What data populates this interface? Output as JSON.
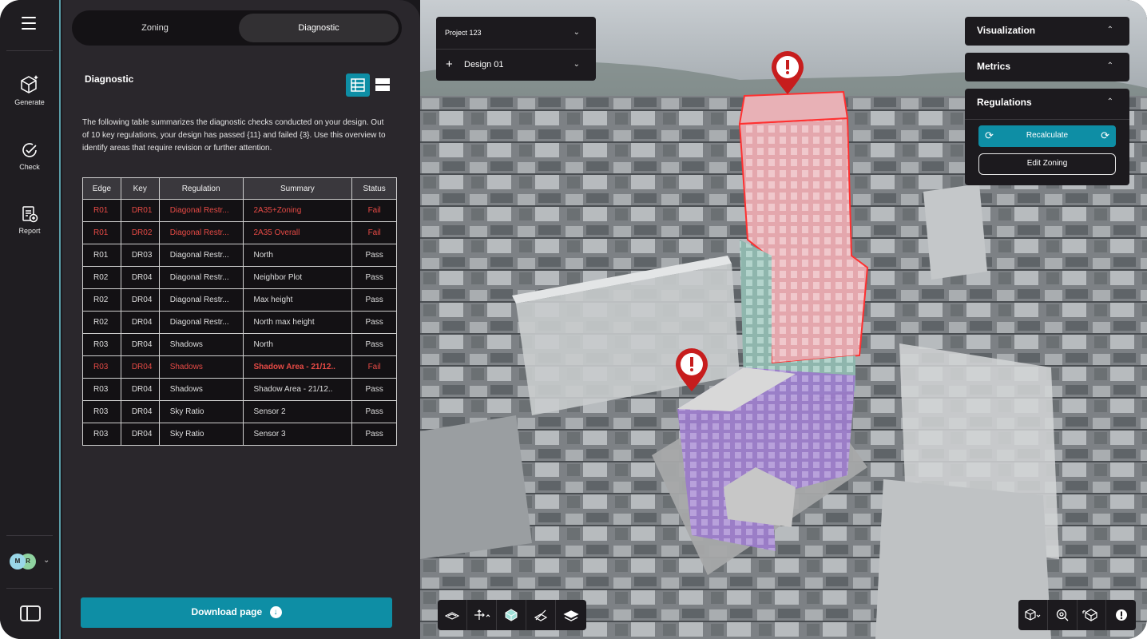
{
  "rail": {
    "items": [
      {
        "label": "Generate",
        "icon": "cube-sparkle-icon"
      },
      {
        "label": "Check",
        "icon": "check-circle-icon"
      },
      {
        "label": "Report",
        "icon": "report-add-icon"
      }
    ],
    "avatars": [
      "M",
      "R"
    ]
  },
  "tabs": {
    "zoning": "Zoning",
    "diagnostic": "Diagnostic"
  },
  "diagnostic": {
    "title": "Diagnostic",
    "intro": "The following table summarizes the diagnostic checks conducted on your design. Out of 10 key regulations, your design has passed {11} and failed {3}. Use this overview to identify areas that require revision or further attention.",
    "columns": [
      "Edge",
      "Key",
      "Regulation",
      "Summary",
      "Status"
    ],
    "rows": [
      {
        "edge": "R01",
        "key": "DR01",
        "regulation": "Diagonal Restr...",
        "summary": "2A35+Zoning",
        "status": "Fail"
      },
      {
        "edge": "R01",
        "key": "DR02",
        "regulation": "Diagonal Restr...",
        "summary": "2A35 Overall",
        "status": "Fail"
      },
      {
        "edge": "R01",
        "key": "DR03",
        "regulation": "Diagonal Restr...",
        "summary": "North",
        "status": "Pass"
      },
      {
        "edge": "R02",
        "key": "DR04",
        "regulation": "Diagonal Restr...",
        "summary": "Neighbor Plot",
        "status": "Pass"
      },
      {
        "edge": "R02",
        "key": "DR04",
        "regulation": "Diagonal Restr...",
        "summary": "Max height",
        "status": "Pass"
      },
      {
        "edge": "R02",
        "key": "DR04",
        "regulation": "Diagonal Restr...",
        "summary": "North max height",
        "status": "Pass"
      },
      {
        "edge": "R03",
        "key": "DR04",
        "regulation": "Shadows",
        "summary": "North",
        "status": "Pass"
      },
      {
        "edge": "R03",
        "key": "DR04",
        "regulation": "Shadows",
        "summary": "Shadow Area - 21/12..",
        "status": "Fail"
      },
      {
        "edge": "R03",
        "key": "DR04",
        "regulation": "Shadows",
        "summary": "Shadow Area - 21/12..",
        "status": "Pass"
      },
      {
        "edge": "R03",
        "key": "DR04",
        "regulation": "Sky Ratio",
        "summary": "Sensor 2",
        "status": "Pass"
      },
      {
        "edge": "R03",
        "key": "DR04",
        "regulation": "Sky Ratio",
        "summary": "Sensor 3",
        "status": "Pass"
      }
    ],
    "download_label": "Download page"
  },
  "project": {
    "name": "Project 123",
    "design": "Design 01"
  },
  "accordions": {
    "visualization": "Visualization",
    "metrics": "Metrics",
    "regulations": "Regulations"
  },
  "regulations": {
    "recalculate": "Recalculate",
    "edit_zoning": "Edit Zoning"
  },
  "colors": {
    "accent": "#0e8ea5",
    "fail": "#e64a45",
    "panel": "#2a272c",
    "rail_border": "#5a9ea8"
  },
  "toolbar_left": [
    "plane-layers-icon",
    "move-axis-icon",
    "solid-cube-icon",
    "section-cut-icon",
    "stack-layers-icon"
  ],
  "toolbar_right": [
    "cube-view-icon",
    "zoom-icon",
    "isometric-icon",
    "info-icon"
  ]
}
